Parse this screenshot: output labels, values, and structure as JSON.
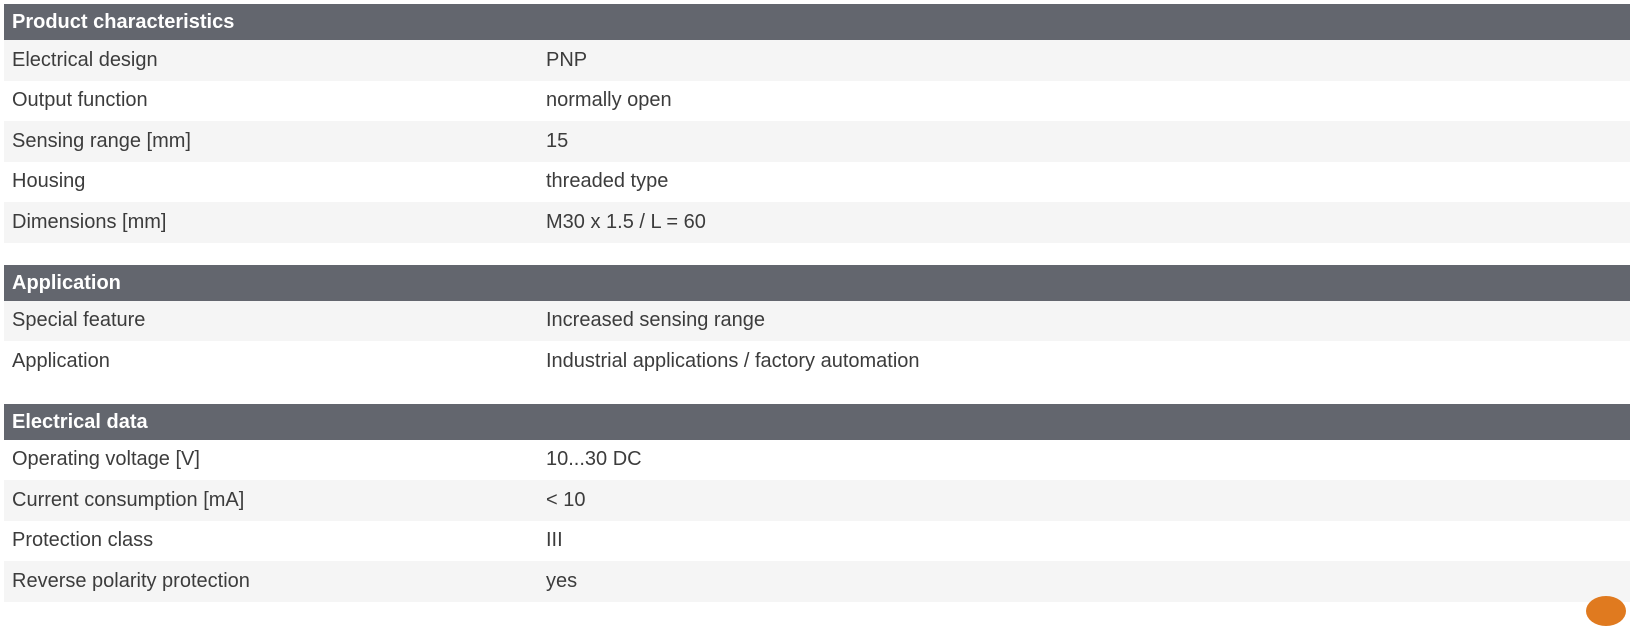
{
  "sections": [
    {
      "title": "Product characteristics",
      "rows": [
        {
          "label": "Electrical design",
          "value": "PNP"
        },
        {
          "label": "Output function",
          "value": "normally open"
        },
        {
          "label": "Sensing range [mm]",
          "value": "15"
        },
        {
          "label": "Housing",
          "value": "threaded type"
        },
        {
          "label": "Dimensions [mm]",
          "value": "M30 x 1.5 / L = 60"
        }
      ]
    },
    {
      "title": "Application",
      "rows": [
        {
          "label": "Special feature",
          "value": "Increased sensing range"
        },
        {
          "label": "Application",
          "value": "Industrial applications / factory automation"
        }
      ]
    },
    {
      "title": "Electrical data",
      "rows": [
        {
          "label": "Operating voltage [V]",
          "value": "10...30 DC"
        },
        {
          "label": "Current consumption [mA]",
          "value": "< 10"
        },
        {
          "label": "Protection class",
          "value": "III"
        },
        {
          "label": "Reverse polarity protection",
          "value": "yes"
        }
      ]
    }
  ],
  "colors": {
    "header_bg": "#63666e",
    "row_alt_bg": "#f5f5f5",
    "accent": "#e07a1f"
  }
}
